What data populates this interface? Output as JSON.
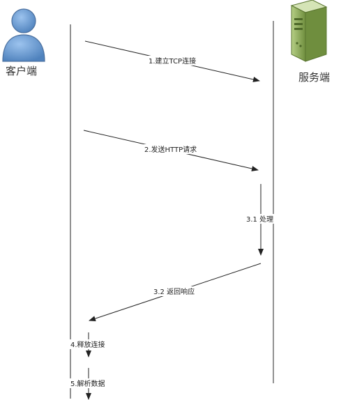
{
  "actors": {
    "client": {
      "label": "客户端",
      "icon": "user-icon",
      "color": "#6a9bd1"
    },
    "server": {
      "label": "服务端",
      "icon": "server-icon",
      "color": "#8fb05a"
    }
  },
  "messages": [
    {
      "label": "1.建立TCP连接",
      "from": "client",
      "to": "server"
    },
    {
      "label": "2.发送HTTP请求",
      "from": "client",
      "to": "server"
    },
    {
      "label": "3.1 处理",
      "from": "server",
      "to": "server"
    },
    {
      "label": "3.2 返回响应",
      "from": "server",
      "to": "client"
    },
    {
      "label": "4.释放连接",
      "from": "client",
      "to": "client"
    },
    {
      "label": "5.解析数据",
      "from": "client",
      "to": "client"
    }
  ],
  "colors": {
    "line": "#222222",
    "text": "#222222"
  }
}
